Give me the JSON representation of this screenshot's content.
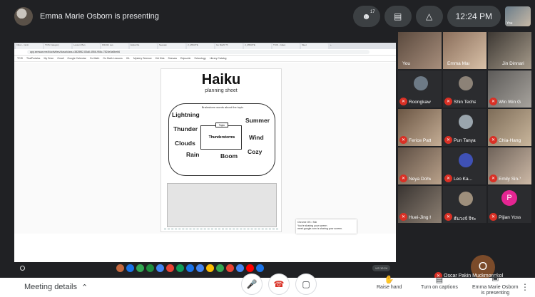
{
  "presenter": {
    "label": "Emma Marie Osborn is presenting"
  },
  "top_right": {
    "people_count": "17",
    "clock": "12:24 PM",
    "self_label": "You"
  },
  "browser": {
    "tabs": [
      "Inbox - mmin",
      "TCIS Category",
      "Lesson Plan",
      "9/24/21 Les",
      "Edpuzzle",
      "Seesaw",
      "2_MINUTE",
      "Go Math! Th",
      "2_MINUTE",
      "TCIS - Calen",
      "Meet",
      "+"
    ],
    "address": "app.seesaw.me/#/activities/class/class.c3828f82-83a8-4556-956c-7824e0a5beb6",
    "bookmarks": [
      "TCIS",
      "ThaiPortalss",
      "My Drive",
      "Gmail",
      "Google Calendar",
      "Go Math",
      "Go Math Lessons",
      "IXL",
      "Mystery Science",
      "Kid Kids",
      "Seesaw",
      "Edpuzzle",
      "Schoology",
      "Library Catalog"
    ]
  },
  "worksheet": {
    "title": "Haiku",
    "subtitle": "planning sheet",
    "hint": "Brainstorm words about the topic",
    "topic_tab": "Topic",
    "topic": "Thunderstorms",
    "words": [
      "Lightning",
      "Summer",
      "Thunder",
      "Wind",
      "Clouds",
      "Cozy",
      "Rain",
      "Boom"
    ]
  },
  "share_popup": {
    "line1": "Chrome OS • Tab",
    "line2": "You're sharing your screen",
    "line3": "meet.google.com is sharing your screen."
  },
  "shelf": {
    "status": "US  12:24"
  },
  "participants": [
    {
      "name": "You"
    },
    {
      "name": "Emma Mari..."
    },
    {
      "name": "Jin Dinnari..."
    },
    {
      "name": "Roongkawin..."
    },
    {
      "name": "Shin Techav..."
    },
    {
      "name": "Win Win Ga..."
    },
    {
      "name": "Ferice Pattar..."
    },
    {
      "name": "Pun Tanyato..."
    },
    {
      "name": "Chia-Hang C..."
    },
    {
      "name": "Neya Dohw..."
    },
    {
      "name": "Leo Ka..."
    },
    {
      "name": "Emily Sin-Yu..."
    },
    {
      "name": "Huei-Jing H..."
    },
    {
      "name": "ธันวงจ์ จิระบ..."
    },
    {
      "name": "Pijian Yossa..."
    }
  ],
  "participant_letter": "P",
  "last_participant": {
    "letter": "O",
    "name": "Oscar Pakin Muckmongkol"
  },
  "bottom": {
    "meeting_details": "Meeting details",
    "raise_hand": "Raise hand",
    "captions": "Turn on captions",
    "presenting_line1": "Emma Marie Osborn",
    "presenting_line2": "is presenting"
  },
  "colors": {
    "stage": "#202124",
    "mic_off": "#d93025",
    "accent": "#1a73e8"
  }
}
